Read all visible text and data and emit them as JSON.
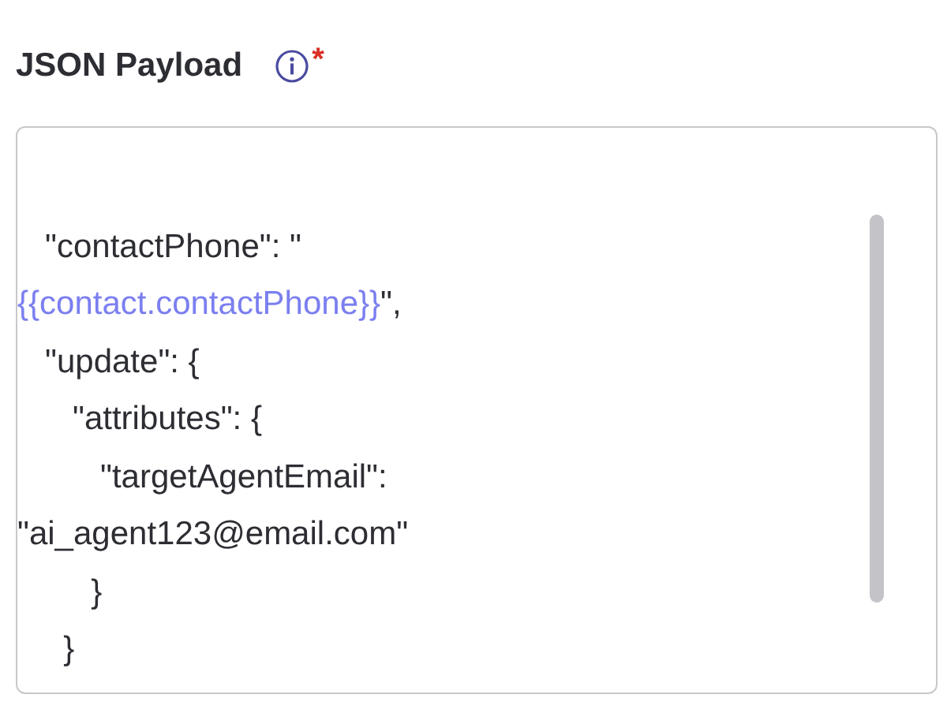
{
  "field": {
    "label": "JSON Payload",
    "required": true,
    "required_mark": "*"
  },
  "editor": {
    "lines": [
      [
        {
          "kind": "plain",
          "text": "   \"contactPhone\": \""
        }
      ],
      [
        {
          "kind": "variable",
          "text": "{{contact.contactPhone}}"
        },
        {
          "kind": "plain",
          "text": "\","
        }
      ],
      [
        {
          "kind": "plain",
          "text": "   \"update\": {"
        }
      ],
      [
        {
          "kind": "plain",
          "text": "      \"attributes\": {"
        }
      ],
      [
        {
          "kind": "plain",
          "text": "         \"targetAgentEmail\":"
        }
      ],
      [
        {
          "kind": "plain",
          "text": "\"ai_agent123@email.com\""
        }
      ],
      [
        {
          "kind": "plain",
          "text": "        }"
        }
      ],
      [
        {
          "kind": "plain",
          "text": "     }"
        }
      ]
    ]
  }
}
